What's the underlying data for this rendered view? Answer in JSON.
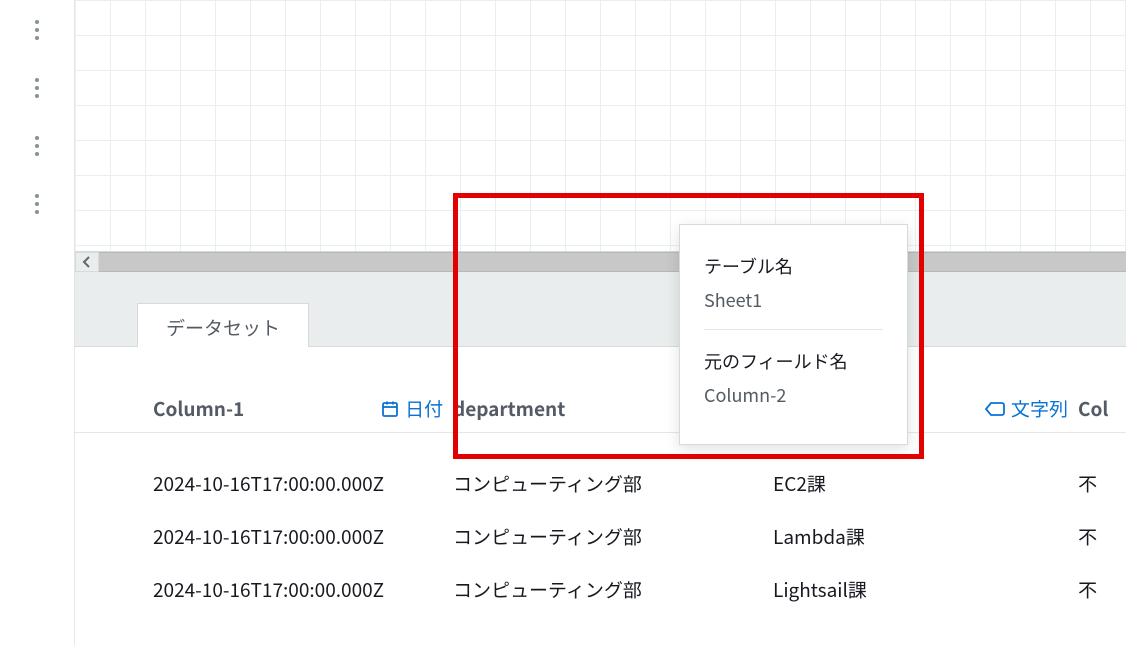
{
  "tab": {
    "active_label": "データセット"
  },
  "columns": [
    {
      "name": "Column-1",
      "type_label": "日付",
      "type_icon": "calendar"
    },
    {
      "name": "department",
      "type_label": "",
      "type_icon": "tag"
    },
    {
      "name": "",
      "type_label": "文字列",
      "type_icon": "tag"
    },
    {
      "name": "Col"
    }
  ],
  "rows": [
    {
      "c1": "2024-10-16T17:00:00.000Z",
      "c2": "コンピューティング部",
      "c3": "EC2課",
      "c4": "不"
    },
    {
      "c1": "2024-10-16T17:00:00.000Z",
      "c2": "コンピューティング部",
      "c3": "Lambda課",
      "c4": "不"
    },
    {
      "c1": "2024-10-16T17:00:00.000Z",
      "c2": "コンピューティング部",
      "c3": "Lightsail課",
      "c4": "不"
    }
  ],
  "tooltip": {
    "table_name_label": "テーブル名",
    "table_name_value": "Sheet1",
    "orig_field_label": "元のフィールド名",
    "orig_field_value": "Column-2"
  }
}
